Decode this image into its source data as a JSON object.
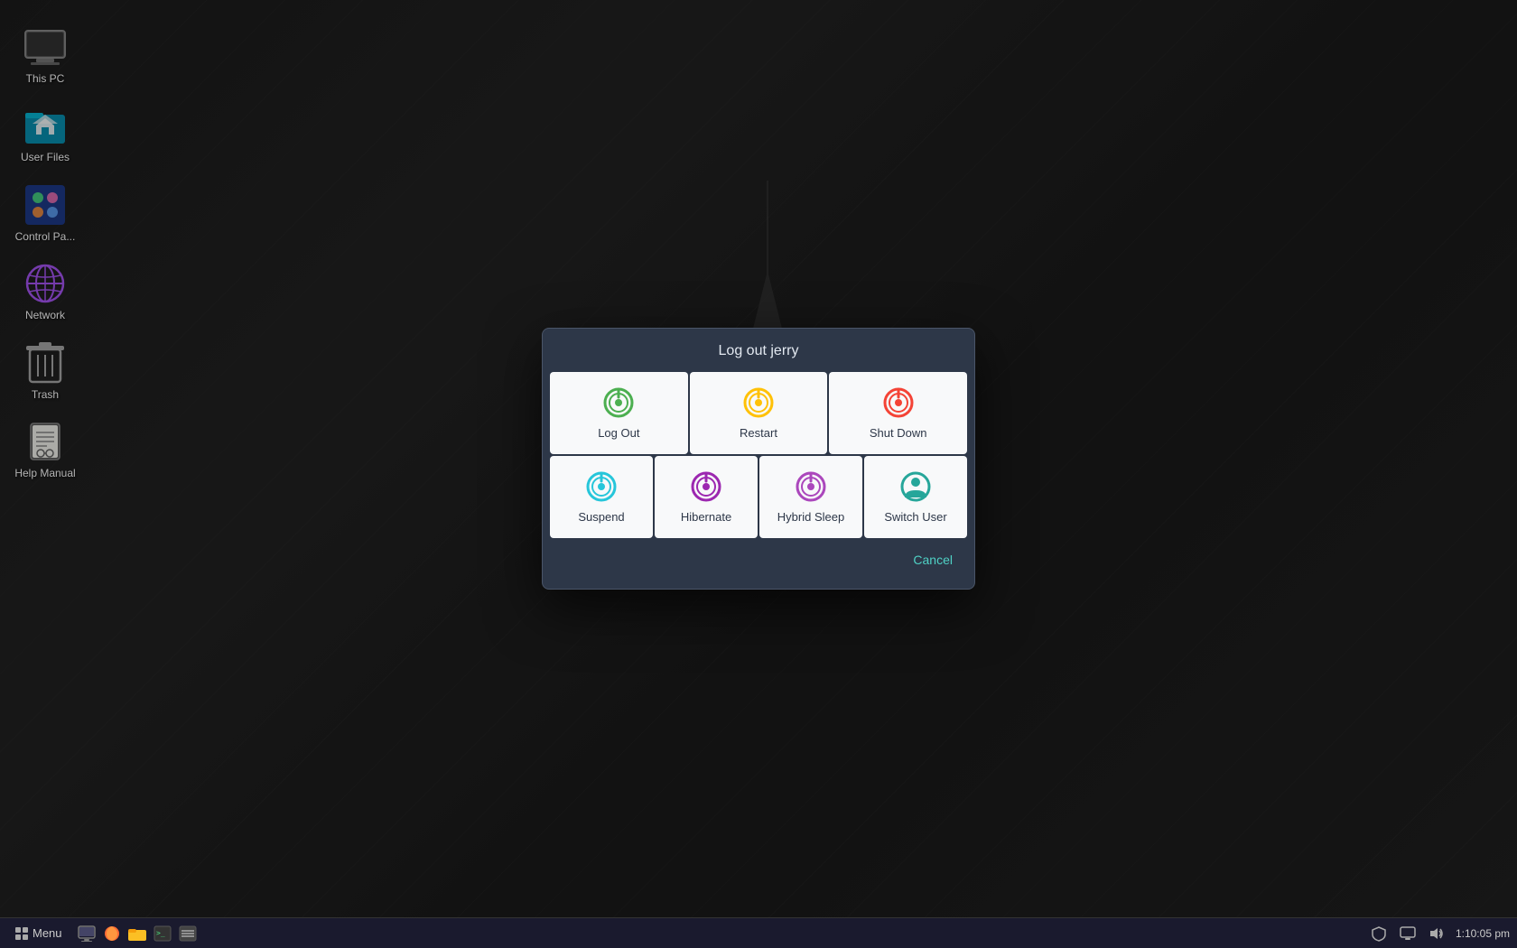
{
  "desktop": {
    "icons": [
      {
        "id": "this-pc",
        "label": "This PC"
      },
      {
        "id": "user-files",
        "label": "User Files"
      },
      {
        "id": "control-panel",
        "label": "Control Pa..."
      },
      {
        "id": "network",
        "label": "Network"
      },
      {
        "id": "trash",
        "label": "Trash"
      },
      {
        "id": "help-manual",
        "label": "Help Manual"
      }
    ]
  },
  "dialog": {
    "title": "Log out jerry",
    "row1": [
      {
        "id": "log-out",
        "label": "Log Out",
        "icon_color": "#4caf50"
      },
      {
        "id": "restart",
        "label": "Restart",
        "icon_color": "#ffc107"
      },
      {
        "id": "shut-down",
        "label": "Shut Down",
        "icon_color": "#f44336"
      }
    ],
    "row2": [
      {
        "id": "suspend",
        "label": "Suspend",
        "icon_color": "#26c6da"
      },
      {
        "id": "hibernate",
        "label": "Hibernate",
        "icon_color": "#9c27b0"
      },
      {
        "id": "hybrid-sleep",
        "label": "Hybrid Sleep",
        "icon_color": "#ab47bc"
      },
      {
        "id": "switch-user",
        "label": "Switch User",
        "icon_color": "#26a69a"
      }
    ],
    "cancel_label": "Cancel"
  },
  "taskbar": {
    "menu_label": "Menu",
    "clock": "1:10:05 pm",
    "icons": [
      "browser",
      "fox-icon",
      "folder-icon",
      "terminal-icon",
      "menu-icon"
    ]
  }
}
